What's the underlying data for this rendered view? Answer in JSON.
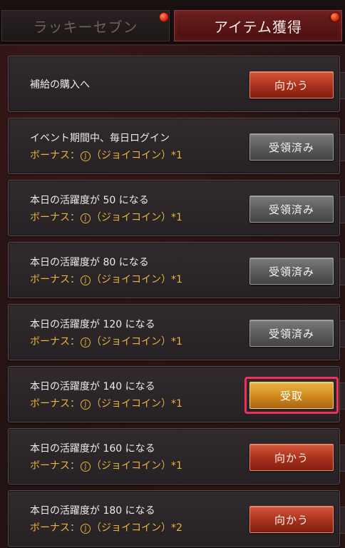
{
  "tabs": [
    {
      "label": "ラッキーセブン",
      "active": false
    },
    {
      "label": "アイテム獲得",
      "active": true
    }
  ],
  "coin_symbol": "J",
  "items": [
    {
      "title": "補給の購入へ",
      "bonus": null,
      "button": "向かう",
      "state": "go"
    },
    {
      "title": "イベント期間中、毎日ログイン",
      "bonus": {
        "prefix": "ボーナス：",
        "suffix": "（ジョイコイン）*1"
      },
      "button": "受領済み",
      "state": "done"
    },
    {
      "title": "本日の活躍度が 50 になる",
      "bonus": {
        "prefix": "ボーナス：",
        "suffix": "（ジョイコイン）*1"
      },
      "button": "受領済み",
      "state": "done"
    },
    {
      "title": "本日の活躍度が 80 になる",
      "bonus": {
        "prefix": "ボーナス：",
        "suffix": "（ジョイコイン）*1"
      },
      "button": "受領済み",
      "state": "done"
    },
    {
      "title": "本日の活躍度が 120 になる",
      "bonus": {
        "prefix": "ボーナス：",
        "suffix": "（ジョイコイン）*1"
      },
      "button": "受領済み",
      "state": "done"
    },
    {
      "title": "本日の活躍度が 140 になる",
      "bonus": {
        "prefix": "ボーナス：",
        "suffix": "（ジョイコイン）*1"
      },
      "button": "受取",
      "state": "claim",
      "highlighted": true
    },
    {
      "title": "本日の活躍度が 160 になる",
      "bonus": {
        "prefix": "ボーナス：",
        "suffix": "（ジョイコイン）*1"
      },
      "button": "向かう",
      "state": "go"
    },
    {
      "title": "本日の活躍度が 180 になる",
      "bonus": {
        "prefix": "ボーナス：",
        "suffix": "（ジョイコイン）*2"
      },
      "button": "向かう",
      "state": "go"
    }
  ],
  "colors": {
    "go_button": "#a8301c",
    "done_button": "#5a5a5a",
    "claim_button": "#d08a1e",
    "bonus_text": "#e8b43a",
    "highlight": "#f0305c"
  }
}
